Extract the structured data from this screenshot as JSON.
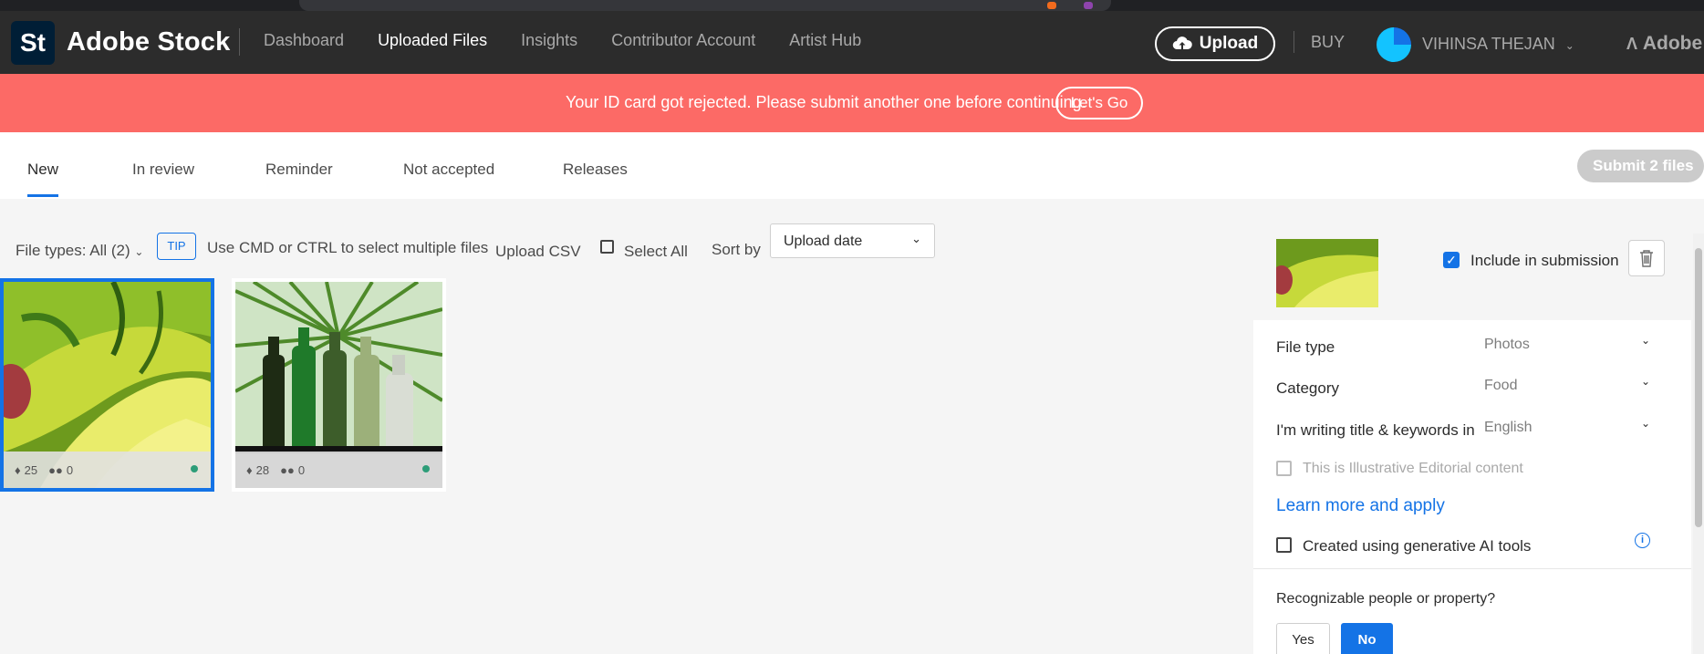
{
  "header": {
    "logo": "St",
    "brand": "Adobe Stock",
    "nav": [
      "Dashboard",
      "Uploaded Files",
      "Insights",
      "Contributor Account",
      "Artist Hub"
    ],
    "active_nav": "Uploaded Files",
    "upload_label": "Upload",
    "buy_label": "BUY",
    "user_name": "VIHINSA THEJAN",
    "adobe_label": "Adobe"
  },
  "banner": {
    "message": "Your ID card got rejected. Please submit another one before continuing.",
    "button": "Let's Go",
    "color": "#fc6a66"
  },
  "tabs": {
    "items": [
      "New",
      "In review",
      "Reminder",
      "Not accepted",
      "Releases"
    ],
    "active": "New",
    "submit_label": "Submit 2 files"
  },
  "toolbar": {
    "file_types": "File types: All (2)",
    "tip_badge": "TIP",
    "tip_text": "Use CMD or CTRL to select multiple files",
    "upload_csv": "Upload CSV",
    "select_all": "Select All",
    "sort_by_label": "Sort by",
    "sort_value": "Upload date"
  },
  "files": [
    {
      "keywords": "25",
      "people": "0",
      "selected": true,
      "status_color": "#2d9d78"
    },
    {
      "keywords": "28",
      "people": "0",
      "selected": false,
      "status_color": "#2d9d78"
    }
  ],
  "panel": {
    "include_label": "Include in submission",
    "file_type_label": "File type",
    "file_type_value": "Photos",
    "category_label": "Category",
    "category_value": "Food",
    "language_label": "I'm writing title & keywords in",
    "language_value": "English",
    "editorial_label": "This is Illustrative Editorial content",
    "learn_more": "Learn more and apply",
    "ai_label": "Created using generative AI tools",
    "people_question": "Recognizable people or property?",
    "yes_label": "Yes",
    "no_label": "No"
  },
  "colors": {
    "accent": "#1473e6",
    "header_bg": "#2c2c2c",
    "status_green": "#2d9d78"
  }
}
